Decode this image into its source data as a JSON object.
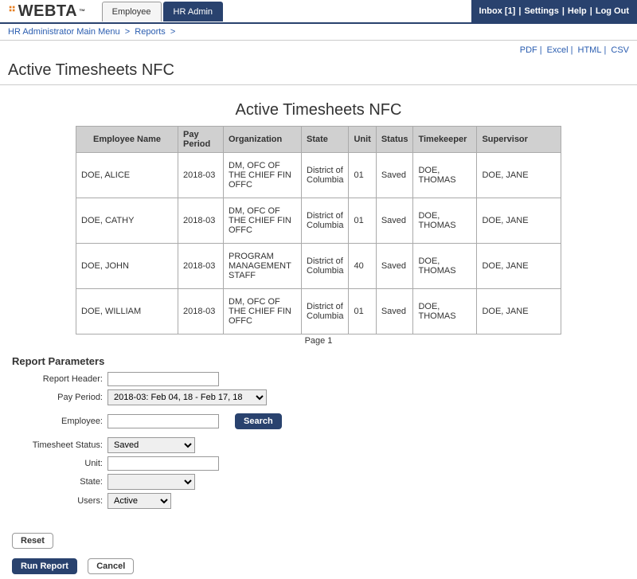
{
  "header": {
    "logo": "WEBTA",
    "logo_tm": "™",
    "tabs": [
      {
        "label": "Employee"
      },
      {
        "label": "HR Admin"
      }
    ],
    "links": {
      "inbox": "Inbox [1]",
      "settings": "Settings",
      "help": "Help",
      "logout": "Log Out"
    }
  },
  "breadcrumb": {
    "items": [
      {
        "label": "HR Administrator Main Menu"
      },
      {
        "label": "Reports"
      }
    ]
  },
  "export": {
    "pdf": "PDF",
    "excel": "Excel",
    "html": "HTML",
    "csv": "CSV"
  },
  "page_title": "Active Timesheets NFC",
  "report": {
    "title": "Active Timesheets NFC",
    "columns": [
      "Employee Name",
      "Pay Period",
      "Organization",
      "State",
      "Unit",
      "Status",
      "Timekeeper",
      "Supervisor"
    ],
    "rows": [
      {
        "employee": "DOE, ALICE",
        "pay_period": "2018-03",
        "organization": "DM, OFC OF THE CHIEF FIN OFFC",
        "state": "District of Columbia",
        "unit": "01",
        "status": "Saved",
        "timekeeper": "DOE, THOMAS",
        "supervisor": "DOE, JANE"
      },
      {
        "employee": "DOE, CATHY",
        "pay_period": "2018-03",
        "organization": "DM, OFC OF THE CHIEF FIN OFFC",
        "state": "District of Columbia",
        "unit": "01",
        "status": "Saved",
        "timekeeper": "DOE, THOMAS",
        "supervisor": "DOE, JANE"
      },
      {
        "employee": "DOE, JOHN",
        "pay_period": "2018-03",
        "organization": "PROGRAM MANAGEMENT STAFF",
        "state": "District of Columbia",
        "unit": "40",
        "status": "Saved",
        "timekeeper": "DOE, THOMAS",
        "supervisor": "DOE, JANE"
      },
      {
        "employee": "DOE, WILLIAM",
        "pay_period": "2018-03",
        "organization": "DM, OFC OF THE CHIEF FIN OFFC",
        "state": "District of Columbia",
        "unit": "01",
        "status": "Saved",
        "timekeeper": "DOE, THOMAS",
        "supervisor": "DOE, JANE"
      }
    ],
    "pagination": "Page 1"
  },
  "params": {
    "title": "Report Parameters",
    "labels": {
      "report_header": "Report Header:",
      "pay_period": "Pay Period:",
      "employee": "Employee:",
      "timesheet_status": "Timesheet Status:",
      "unit": "Unit:",
      "state": "State:",
      "users": "Users:"
    },
    "values": {
      "report_header": "",
      "pay_period": "2018-03: Feb 04, 18 - Feb 17, 18",
      "employee": "",
      "timesheet_status": "Saved",
      "unit": "",
      "state": "",
      "users": "Active"
    },
    "search_btn": "Search"
  },
  "buttons": {
    "reset": "Reset",
    "run_report": "Run Report",
    "cancel": "Cancel"
  }
}
